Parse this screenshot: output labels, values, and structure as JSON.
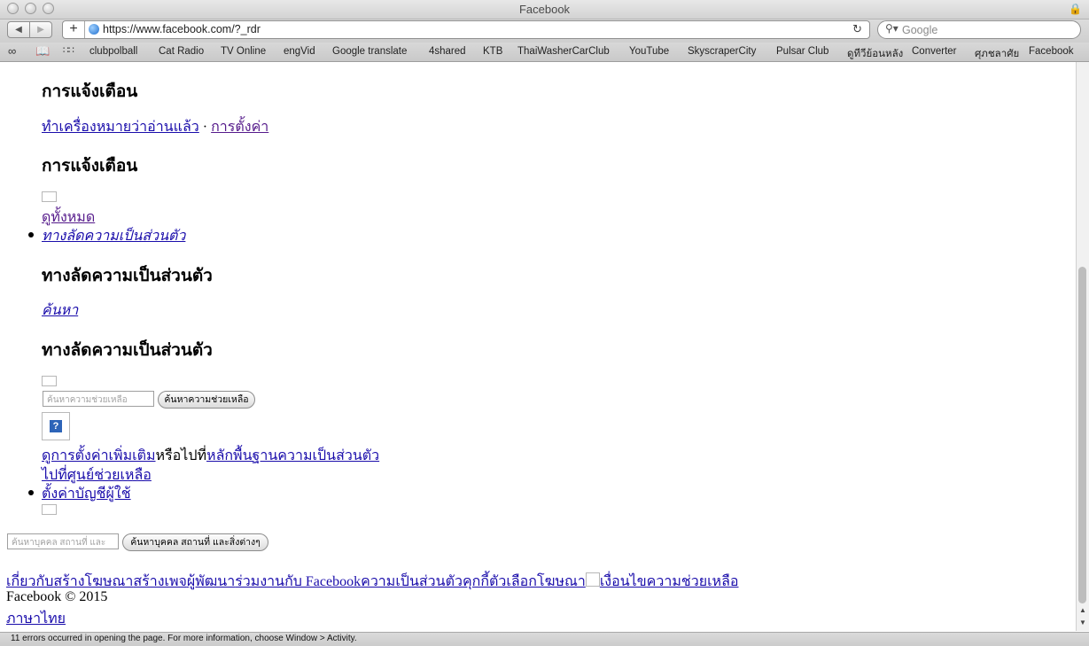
{
  "window": {
    "title": "Facebook"
  },
  "toolbar": {
    "back_label": "◀",
    "forward_label": "▶",
    "add_label": "+",
    "url": "https://www.facebook.com/?_rdr",
    "search_placeholder": "Google"
  },
  "bookmarks": [
    "clubpolball",
    "Cat Radio",
    "TV Online",
    "engVid",
    "Google translate",
    "4shared",
    "KTB",
    "ThaiWasherCarClub",
    "YouTube",
    "SkyscraperCity",
    "Pulsar Club",
    "ดูทีวีย้อนหลัง",
    "Converter",
    "ศุภชลาศัย",
    "Facebook"
  ],
  "content": {
    "notifications_heading_1": "การแจ้งเตือน",
    "mark_read_link": "ทำเครื่องหมายว่าอ่านแล้ว",
    "separator": "·",
    "settings_link": "การตั้งค่า",
    "notifications_heading_2": "การแจ้งเตือน",
    "see_all_link": "ดูทั้งหมด",
    "privacy_shortcuts_link": "ทางลัดความเป็นส่วนตัว",
    "privacy_heading_1": "ทางลัดความเป็นส่วนตัว",
    "search_link": "ค้นหา",
    "privacy_heading_2": "ทางลัดความเป็นส่วนตัว",
    "help_search_placeholder": "ค้นหาความช่วยเหลือ",
    "help_search_button": "ค้นหาความช่วยเหลือ",
    "help_icon": "?",
    "more_settings_link": "ดูการตั้งค่าเพิ่มเติม",
    "or_go_text": "หรือไปที่",
    "privacy_basics_link": "หลักพื้นฐานความเป็นส่วนตัว",
    "help_center_link": "ไปที่ศูนย์ช่วยเหลือ",
    "account_settings_link": "ตั้งค่าบัญชีผู้ใช้",
    "people_search_placeholder": "ค้นหาบุคคล สถานที่ และสิ่งต่างๆ",
    "people_search_button": "ค้นหาบุคคล สถานที่ และสิ่งต่างๆ"
  },
  "footer": {
    "links": [
      "เกี่ยวกับ",
      "สร้างโฆษณา",
      "สร้างเพจ",
      "ผู้พัฒนา",
      "ร่วมงานกับ Facebook",
      "ความเป็นส่วนตัว",
      "คุกกี้",
      "ตัวเลือกโฆษณา"
    ],
    "links_after_box": [
      "เงื่อนไข",
      "ความช่วยเหลือ"
    ],
    "copyright": "Facebook © 2015",
    "language_link": "ภาษาไทย"
  },
  "status": {
    "message": "11 errors occurred in opening the page. For more information, choose Window > Activity."
  },
  "icons": [
    "close-button",
    "minimize-button",
    "zoom-button",
    "lock-icon",
    "globe-icon",
    "reload-icon",
    "magnifier-icon",
    "reading-glasses-icon",
    "book-icon",
    "grid-icon",
    "help-icon"
  ]
}
